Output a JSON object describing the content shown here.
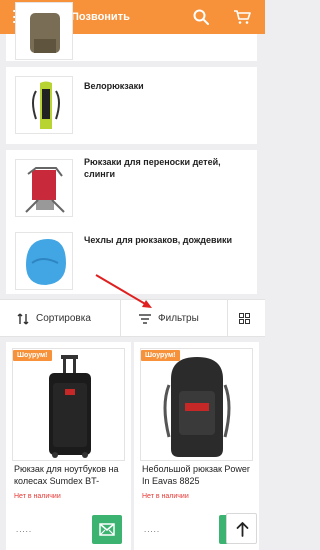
{
  "header": {
    "call_label": "Позвонить",
    "icons": [
      "hamburger-icon",
      "phone-icon",
      "search-icon",
      "cart-icon"
    ],
    "bg_color": "#f7923a"
  },
  "categories": [
    {
      "label": ""
    },
    {
      "label": "Велорюкзаки"
    },
    {
      "label_line1": "Рюкзаки для переноски детей,",
      "label_line2": "слинги"
    },
    {
      "label": "Чехлы для рюкзаков, дождевики"
    }
  ],
  "toolbar": {
    "sort_label": "Сортировка",
    "filter_label": "Фильтры"
  },
  "products": [
    {
      "badge": "Шоурум!",
      "name": "Рюкзак для ноутбуков на колесах Sumdex BT-",
      "stock": "Нет в наличии",
      "price": "....."
    },
    {
      "badge": "Шоурум!",
      "name": "Небольшой рюкзак Power In Eavas 8825",
      "stock": "Нет в наличии",
      "price": "....."
    }
  ],
  "colors": {
    "accent": "#f7923a",
    "out_of_stock": "#e53935",
    "action_green": "#3cb371",
    "annotation_arrow": "#e02020"
  }
}
